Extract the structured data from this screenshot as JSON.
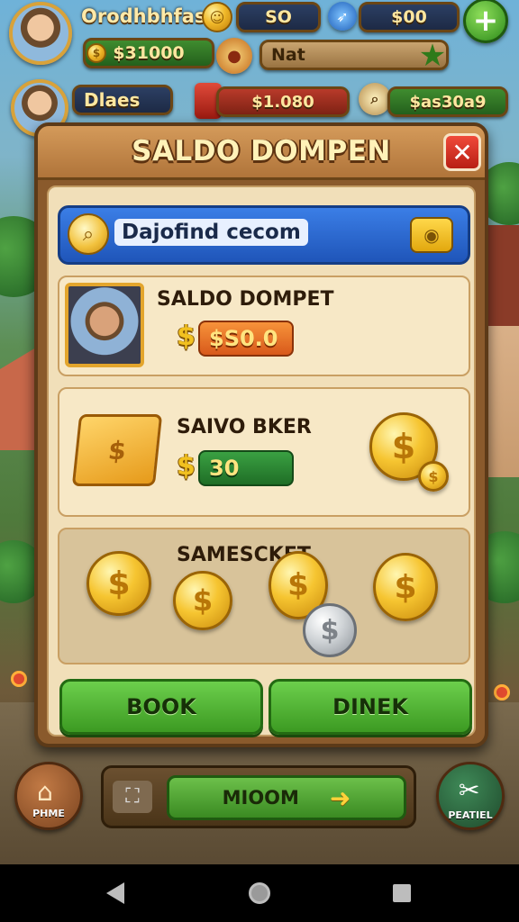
{
  "hud": {
    "player_name": "Orodhbhfas",
    "stat_1": "SO",
    "stat_2": "$00",
    "balance": "$31000",
    "tag": "Nat",
    "second_name": "Dlaes",
    "second_value": "$1.080",
    "third_value": "$as30a9"
  },
  "dialog": {
    "title": "SALDO DOMPEN",
    "search_text": "Dajofind cecom",
    "card1": {
      "title": "SALDO DOMPET",
      "currency": "$",
      "amount": "$S0.0"
    },
    "card2": {
      "title": "SAIVO BKER",
      "currency": "$",
      "amount": "30"
    },
    "card3": {
      "title": "SAMESCKET"
    },
    "btn_left": "BOOK",
    "btn_right": "DINEK"
  },
  "bottom": {
    "home_label": "PHME",
    "center_label": "MIOOM",
    "right_label": "PEATIEL"
  },
  "icons": {
    "close": "close-icon",
    "search": "search-icon",
    "plus": "plus-icon",
    "home": "home-icon",
    "arrow": "arrow-right-icon"
  },
  "colors": {
    "dialog_frame": "#8a5a2c",
    "search_bar": "#3b7ee6",
    "action_button": "#4caf2f",
    "close_button": "#d8352a",
    "amount_orange": "#e8762a",
    "amount_green": "#2a8a34"
  }
}
